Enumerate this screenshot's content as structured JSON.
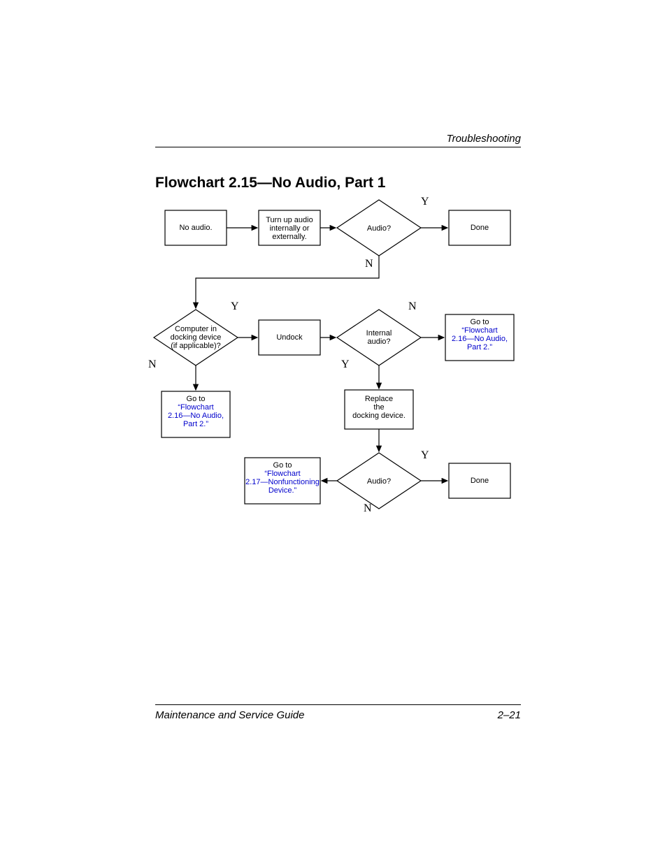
{
  "header": {
    "section": "Troubleshooting"
  },
  "footer": {
    "left": "Maintenance and Service Guide",
    "right": "2–21"
  },
  "title": "Flowchart 2.15—No Audio, Part 1",
  "nodes": {
    "start": {
      "lines": [
        "No audio."
      ]
    },
    "turnup": {
      "lines": [
        "Turn up audio",
        "internally or",
        "externally."
      ]
    },
    "audio1": {
      "lines": [
        "Audio?"
      ]
    },
    "done1": {
      "lines": [
        "Done"
      ]
    },
    "docking": {
      "lines": [
        "Computer in",
        "docking device",
        "(if applicable)?"
      ]
    },
    "undock": {
      "lines": [
        "Undock"
      ]
    },
    "internal": {
      "lines": [
        "Internal",
        "audio?"
      ]
    },
    "goto216a": {
      "plain": "Go to",
      "link": "\"Flowchart 2.16—No Audio, Part 2.\""
    },
    "goto216b": {
      "plain": "Go to",
      "link": "\"Flowchart 2.16—No Audio, Part 2.\""
    },
    "replace": {
      "lines": [
        "Replace",
        "the",
        "docking device."
      ]
    },
    "audio2": {
      "lines": [
        "Audio?"
      ]
    },
    "done2": {
      "lines": [
        "Done"
      ]
    },
    "goto217": {
      "plain": "Go to",
      "link": "\"Flowchart 2.17—Nonfunctioning Device.\""
    }
  },
  "edgelabels": {
    "audio1_y": "Y",
    "audio1_n": "N",
    "dock_y": "Y",
    "dock_n": "N",
    "int_y": "Y",
    "int_n": "N",
    "audio2_y": "Y",
    "audio2_n": "N"
  }
}
